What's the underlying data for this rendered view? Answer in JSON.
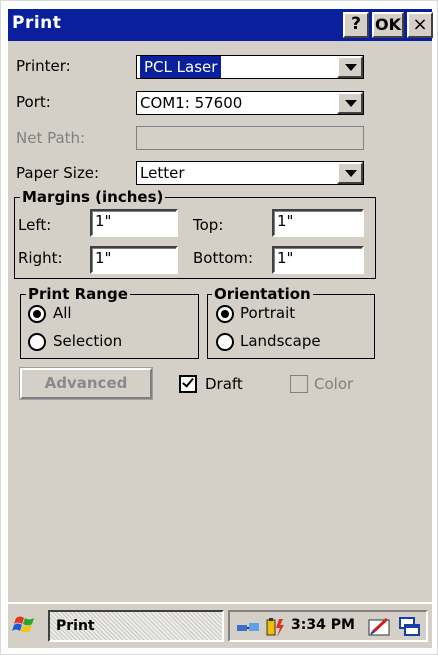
{
  "window": {
    "title": "Print",
    "help_label": "?",
    "ok_label": "OK",
    "close_label": "×"
  },
  "printer": {
    "label": "Printer:",
    "value": "PCL Laser"
  },
  "port": {
    "label": "Port:",
    "value": "COM1: 57600"
  },
  "net_path": {
    "label": "Net Path:",
    "value": ""
  },
  "paper_size": {
    "label": "Paper Size:",
    "value": "Letter"
  },
  "margins": {
    "title": "Margins (inches)",
    "left_label": "Left:",
    "left_value": "1\"",
    "top_label": "Top:",
    "top_value": "1\"",
    "right_label": "Right:",
    "right_value": "1\"",
    "bottom_label": "Bottom:",
    "bottom_value": "1\""
  },
  "print_range": {
    "title": "Print Range",
    "options": [
      "All",
      "Selection"
    ],
    "selected": "All"
  },
  "orientation": {
    "title": "Orientation",
    "options": [
      "Portrait",
      "Landscape"
    ],
    "selected": "Portrait"
  },
  "advanced_label": "Advanced",
  "draft": {
    "label": "Draft",
    "checked": true
  },
  "color": {
    "label": "Color",
    "checked": false,
    "enabled": false
  },
  "taskbar": {
    "task_label": "Print",
    "clock": "3:34 PM"
  },
  "colors": {
    "titlebar": "#0a1f9c",
    "dialog_bg": "#d4d0c8",
    "disabled_text": "#808080"
  },
  "icons": [
    "windows-start-icon",
    "network-icon",
    "battery-icon",
    "input-panel-icon",
    "switch-window-icon"
  ]
}
